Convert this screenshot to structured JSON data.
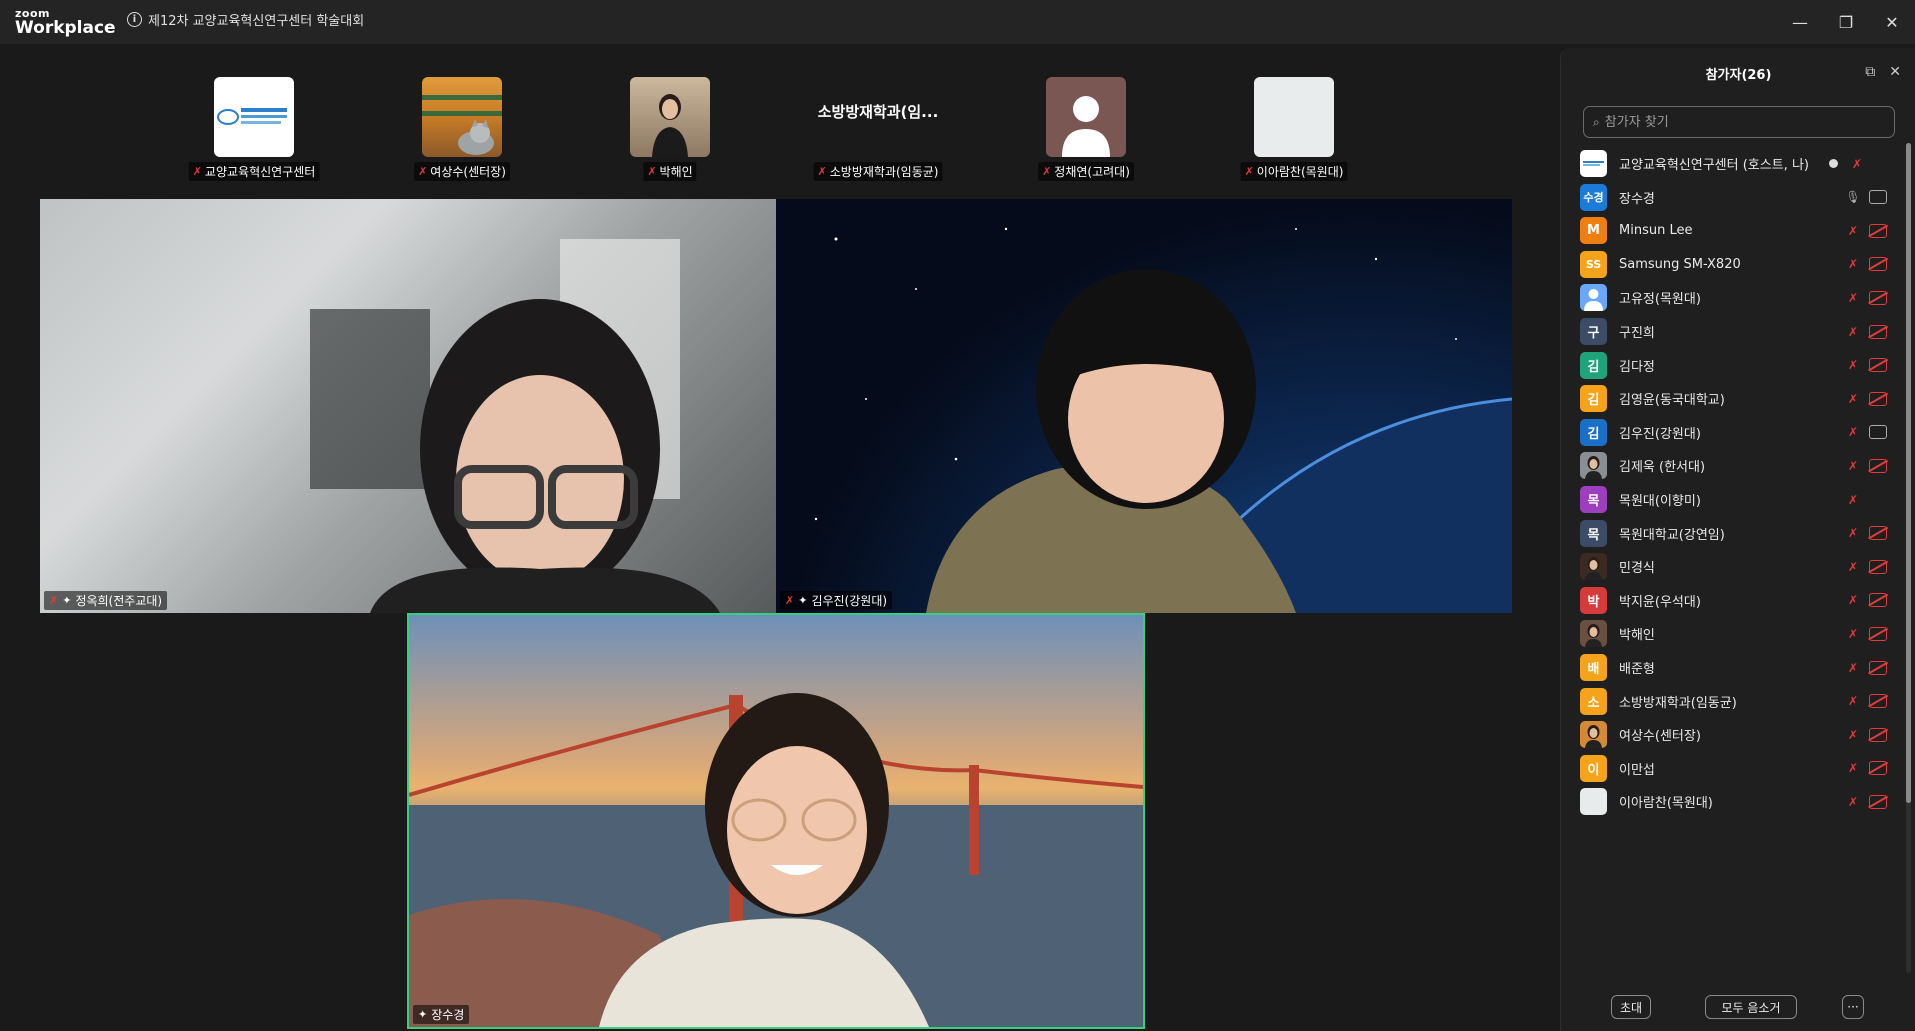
{
  "app": {
    "logo_small": "zoom",
    "logo_big": "Workplace"
  },
  "meeting": {
    "title": "제12차 교양교육혁신연구센터 학술대회"
  },
  "window": {
    "minimize": "—",
    "restore": "❐",
    "close": "✕"
  },
  "strip": [
    {
      "label": "교양교육혁신연구센터",
      "thumb_kind": "logo"
    },
    {
      "label": "여상수(센터장)",
      "thumb_kind": "photo-cat"
    },
    {
      "label": "박해인",
      "thumb_kind": "photo-person"
    },
    {
      "label": "소방방재학과(임동균)",
      "thumb_kind": "text",
      "thumb_text": "소방방재학과(임..."
    },
    {
      "label": "정채연(고려대)",
      "thumb_kind": "silhouette"
    },
    {
      "label": "이아람찬(목원대)",
      "thumb_kind": "blank"
    }
  ],
  "videos": [
    {
      "label": "정옥희(전주교대)",
      "muted": true,
      "pinned": true
    },
    {
      "label": "김우진(강원대)",
      "muted": true,
      "pinned": true
    },
    {
      "label": "장수경",
      "muted": false,
      "pinned": true,
      "active_speaker": true
    }
  ],
  "panel": {
    "title": "참가자(26)",
    "search_placeholder": "참가자 찾기",
    "participants": [
      {
        "name": "교양교육혁신연구센터 (호스트, 나)",
        "avatar_text": "",
        "avatar_color": "#ffffff",
        "avatar_kind": "logo",
        "mic": "muted",
        "cam": "none",
        "recording": true
      },
      {
        "name": "장수경",
        "avatar_text": "수경",
        "avatar_color": "#1a7bd8",
        "mic": "on",
        "cam": "on"
      },
      {
        "name": "Minsun Lee",
        "avatar_text": "M",
        "avatar_color": "#f07f12",
        "mic": "muted",
        "cam": "off"
      },
      {
        "name": "Samsung SM-X820",
        "avatar_text": "SS",
        "avatar_color": "#f5a31a",
        "mic": "muted",
        "cam": "off"
      },
      {
        "name": "고유정(목원대)",
        "avatar_text": "",
        "avatar_color": "#6aa7f8",
        "avatar_kind": "person",
        "mic": "muted",
        "cam": "off"
      },
      {
        "name": "구진희",
        "avatar_text": "구",
        "avatar_color": "#3c4b66",
        "mic": "muted",
        "cam": "off"
      },
      {
        "name": "김다정",
        "avatar_text": "김",
        "avatar_color": "#1fa37a",
        "mic": "muted",
        "cam": "off"
      },
      {
        "name": "김영윤(동국대학교)",
        "avatar_text": "김",
        "avatar_color": "#f5a31a",
        "mic": "muted",
        "cam": "off"
      },
      {
        "name": "김우진(강원대)",
        "avatar_text": "김",
        "avatar_color": "#1a6fc7",
        "mic": "muted",
        "cam": "on"
      },
      {
        "name": "김제욱 (한서대)",
        "avatar_text": "",
        "avatar_color": "#8a8f94",
        "avatar_kind": "photo",
        "mic": "muted",
        "cam": "off"
      },
      {
        "name": "목원대(이향미)",
        "avatar_text": "목",
        "avatar_color": "#9b3fbf",
        "mic": "muted",
        "cam": "none"
      },
      {
        "name": "목원대학교(강연임)",
        "avatar_text": "목",
        "avatar_color": "#3c4b66",
        "mic": "muted",
        "cam": "off"
      },
      {
        "name": "민경식",
        "avatar_text": "",
        "avatar_color": "#3a2a22",
        "avatar_kind": "photo",
        "mic": "muted",
        "cam": "off"
      },
      {
        "name": "박지윤(우석대)",
        "avatar_text": "박",
        "avatar_color": "#d63b3b",
        "mic": "muted",
        "cam": "off"
      },
      {
        "name": "박해인",
        "avatar_text": "",
        "avatar_color": "#6a5040",
        "avatar_kind": "photo",
        "mic": "muted",
        "cam": "off"
      },
      {
        "name": "배준형",
        "avatar_text": "배",
        "avatar_color": "#f5a31a",
        "mic": "muted",
        "cam": "off"
      },
      {
        "name": "소방방재학과(임동균)",
        "avatar_text": "소",
        "avatar_color": "#f5a31a",
        "mic": "muted",
        "cam": "off"
      },
      {
        "name": "여상수(센터장)",
        "avatar_text": "",
        "avatar_color": "#d48a35",
        "avatar_kind": "photo",
        "mic": "muted",
        "cam": "off"
      },
      {
        "name": "이만섭",
        "avatar_text": "이",
        "avatar_color": "#f5a31a",
        "mic": "muted",
        "cam": "off"
      },
      {
        "name": "이아람찬(목원대)",
        "avatar_text": "",
        "avatar_color": "#e8ebec",
        "avatar_kind": "blank",
        "mic": "muted",
        "cam": "off"
      }
    ],
    "footer": {
      "invite": "초대",
      "mute_all": "모두 음소거",
      "more": "···"
    }
  }
}
